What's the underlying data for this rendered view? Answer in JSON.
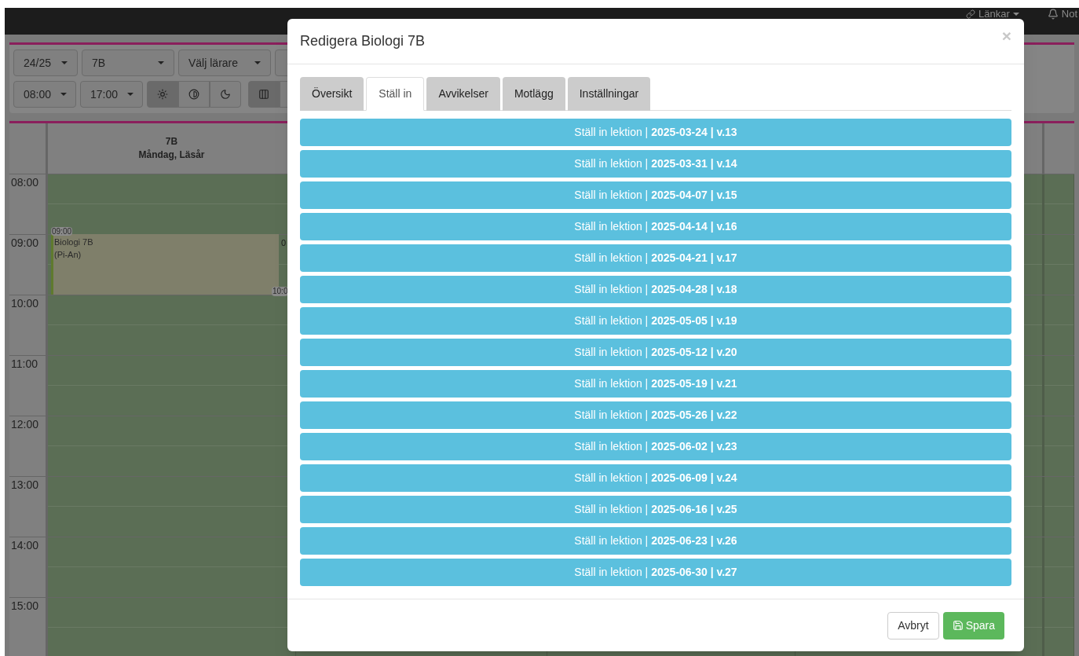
{
  "navbar": {
    "links": {
      "label": "Länkar"
    },
    "notifications": {
      "label": "Not"
    }
  },
  "toolbar": {
    "row_1": [
      {
        "kind": "dropdown",
        "label": "24/25"
      },
      {
        "kind": "dropdown",
        "label": "7B"
      },
      {
        "kind": "dropdown",
        "label": "Välj lärare"
      }
    ],
    "row_2": [
      {
        "kind": "dropdown",
        "label": "08:00"
      },
      {
        "kind": "dropdown",
        "label": "17:00"
      }
    ],
    "theme_toggles": [
      {
        "kind": "sun",
        "selected": true
      },
      {
        "kind": "contrast",
        "selected": false
      },
      {
        "kind": "moon",
        "selected": false
      }
    ],
    "view_toggles": [
      {
        "kind": "columns",
        "selected": true
      }
    ]
  },
  "calendar": {
    "column": {
      "title": "7B",
      "subtitle": "Måndag, Läsår"
    },
    "times": [
      "08:00",
      "09:00",
      "10:00",
      "11:00",
      "12:00",
      "13:00",
      "14:00",
      "15:00"
    ],
    "event": {
      "start": "09:00",
      "title": "Biologi 7B",
      "teacher": "(Pi-An)",
      "end": "10:0",
      "column_2_fragment": "0"
    }
  },
  "modal": {
    "title": "Redigera Biologi 7B",
    "close": "×",
    "tabs": [
      {
        "label": "Översikt",
        "selected": false
      },
      {
        "label": "Ställ in",
        "selected": true
      },
      {
        "label": "Avvikelser",
        "selected": false
      },
      {
        "label": "Motlägg",
        "selected": false
      },
      {
        "label": "Inställningar",
        "selected": false
      }
    ],
    "items": [
      {
        "label": "Ställ in lektion | **2025-03-24 | v.13**"
      },
      {
        "label": "Ställ in lektion | **2025-03-31 | v.14**"
      },
      {
        "label": "Ställ in lektion | **2025-04-07 | v.15**"
      },
      {
        "label": "Ställ in lektion | **2025-04-14 | v.16**"
      },
      {
        "label": "Ställ in lektion | **2025-04-21 | v.17**"
      },
      {
        "label": "Ställ in lektion | **2025-04-28 | v.18**"
      },
      {
        "label": "Ställ in lektion | **2025-05-05 | v.19**"
      },
      {
        "label": "Ställ in lektion | **2025-05-12 | v.20**"
      },
      {
        "label": "Ställ in lektion | **2025-05-19 | v.21**"
      },
      {
        "label": "Ställ in lektion | **2025-05-26 | v.22**"
      },
      {
        "label": "Ställ in lektion | **2025-06-02 | v.23**"
      },
      {
        "label": "Ställ in lektion | **2025-06-09 | v.24**"
      },
      {
        "label": "Ställ in lektion | **2025-06-16 | v.25**"
      },
      {
        "label": "Ställ in lektion | **2025-06-23 | v.26**"
      },
      {
        "label": "Ställ in lektion | **2025-06-30 | v.27**"
      }
    ],
    "buttons": {
      "cancel": "Avbryt",
      "save": "Spara"
    }
  }
}
